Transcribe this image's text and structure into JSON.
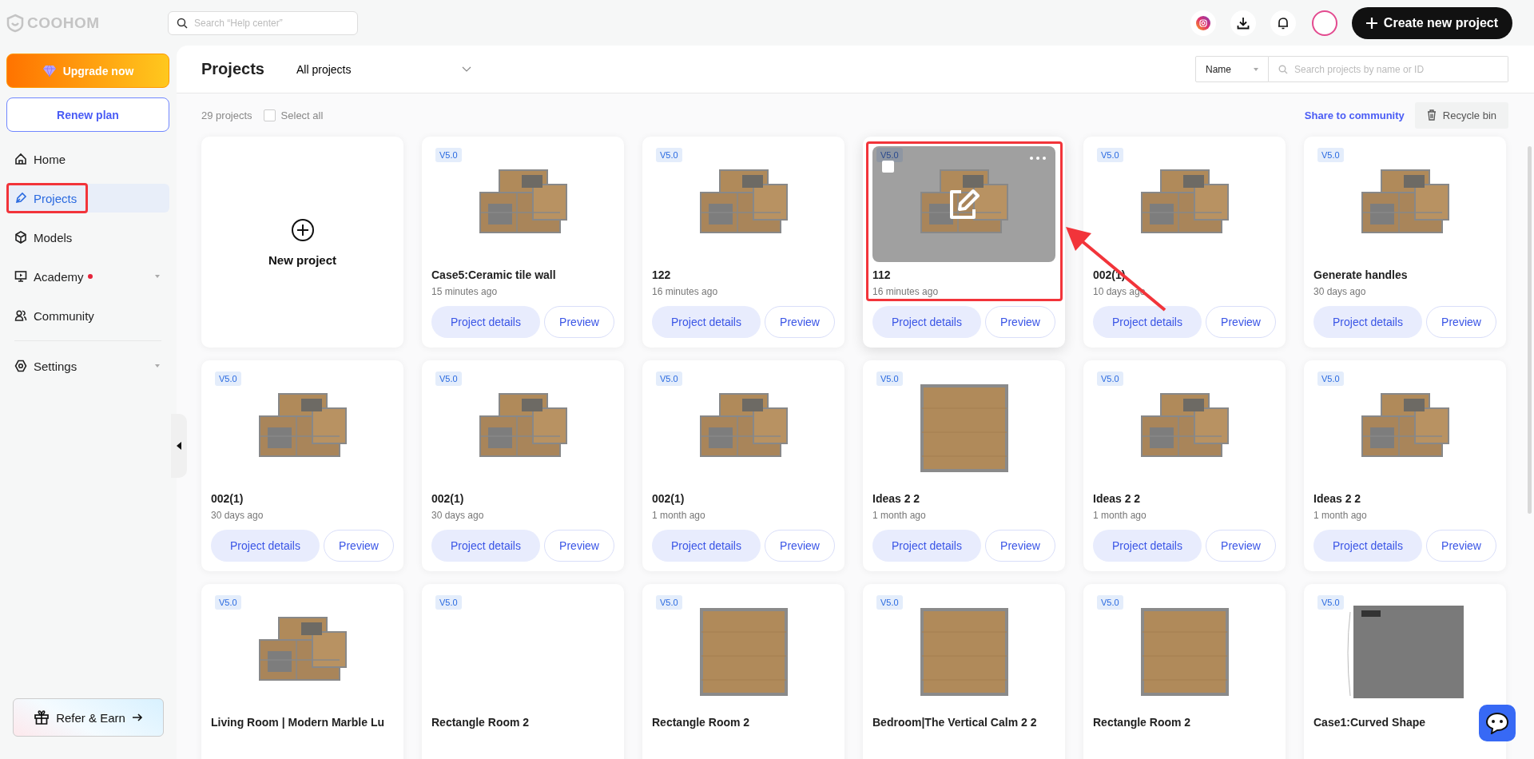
{
  "topbar": {
    "logo": "COOHOM",
    "search": {
      "placeholder": "Search “Help center”"
    },
    "create_button": "Create new project"
  },
  "sidebar": {
    "upgrade_button": "Upgrade now",
    "renew_button": "Renew plan",
    "items": [
      {
        "label": "Home",
        "kind": "home",
        "selected": false,
        "highlighted": false,
        "dot": false,
        "expandable": false
      },
      {
        "label": "Projects",
        "kind": "pen",
        "selected": true,
        "highlighted": true,
        "dot": false,
        "expandable": false
      },
      {
        "label": "Models",
        "kind": "cube",
        "selected": false,
        "highlighted": false,
        "dot": false,
        "expandable": false
      },
      {
        "label": "Academy",
        "kind": "monitor",
        "selected": false,
        "highlighted": false,
        "dot": true,
        "expandable": true
      },
      {
        "label": "Community",
        "kind": "people",
        "selected": false,
        "highlighted": false,
        "dot": false,
        "expandable": false
      },
      {
        "label": "Settings",
        "kind": "gear",
        "selected": false,
        "highlighted": false,
        "dot": false,
        "expandable": true
      }
    ],
    "refer_button": "Refer & Earn"
  },
  "header": {
    "title": "Projects",
    "filter": "All projects",
    "sort": "Name",
    "search": {
      "placeholder": "Search projects by name or ID"
    }
  },
  "toolbar": {
    "count": "29 projects",
    "select_all": {
      "label": "Select all",
      "checked": false
    },
    "share_link": "Share to community",
    "recycle_button": "Recycle bin"
  },
  "cards": [
    {
      "kind": "new",
      "label": "New project"
    },
    {
      "kind": "project",
      "badge": "V5.0",
      "title": "Case5:Ceramic tile wall",
      "time": "15 minutes ago",
      "has_thumbnail": true,
      "hovered": false,
      "highlighted": false,
      "details_button": "Project details",
      "preview_button": "Preview"
    },
    {
      "kind": "project",
      "badge": "V5.0",
      "title": "122",
      "time": "16 minutes ago",
      "has_thumbnail": true,
      "hovered": false,
      "highlighted": false,
      "details_button": "Project details",
      "preview_button": "Preview"
    },
    {
      "kind": "project",
      "badge": "V5.0",
      "title": "112",
      "time": "16 minutes ago",
      "has_thumbnail": true,
      "hovered": true,
      "highlighted": true,
      "details_button": "Project details",
      "preview_button": "Preview"
    },
    {
      "kind": "project",
      "badge": "V5.0",
      "title": "002(1)",
      "time": "10 days ago",
      "has_thumbnail": true,
      "hovered": false,
      "highlighted": false,
      "details_button": "Project details",
      "preview_button": "Preview"
    },
    {
      "kind": "project",
      "badge": "V5.0",
      "title": "Generate handles",
      "time": "30 days ago",
      "has_thumbnail": true,
      "hovered": false,
      "highlighted": false,
      "details_button": "Project details",
      "preview_button": "Preview"
    },
    {
      "kind": "project",
      "badge": "V5.0",
      "title": "002(1)",
      "time": "30 days ago",
      "has_thumbnail": true,
      "hovered": false,
      "highlighted": false,
      "details_button": "Project details",
      "preview_button": "Preview"
    },
    {
      "kind": "project",
      "badge": "V5.0",
      "title": "002(1)",
      "time": "30 days ago",
      "has_thumbnail": true,
      "hovered": false,
      "highlighted": false,
      "details_button": "Project details",
      "preview_button": "Preview"
    },
    {
      "kind": "project",
      "badge": "V5.0",
      "title": "002(1)",
      "time": "1 month ago",
      "has_thumbnail": true,
      "hovered": false,
      "highlighted": false,
      "details_button": "Project details",
      "preview_button": "Preview"
    },
    {
      "kind": "project",
      "badge": "V5.0",
      "title": "Ideas 2 2",
      "time": "1 month ago",
      "has_thumbnail": true,
      "hovered": false,
      "highlighted": false,
      "details_button": "Project details",
      "preview_button": "Preview"
    },
    {
      "kind": "project",
      "badge": "V5.0",
      "title": "Ideas 2 2",
      "time": "1 month ago",
      "has_thumbnail": true,
      "hovered": false,
      "highlighted": false,
      "details_button": "Project details",
      "preview_button": "Preview"
    },
    {
      "kind": "project",
      "badge": "V5.0",
      "title": "Ideas 2 2",
      "time": "1 month ago",
      "has_thumbnail": true,
      "hovered": false,
      "highlighted": false,
      "details_button": "Project details",
      "preview_button": "Preview"
    },
    {
      "kind": "project",
      "badge": "V5.0",
      "title": "Living Room | Modern Marble Lu",
      "has_thumbnail": true,
      "hovered": false,
      "highlighted": false
    },
    {
      "kind": "project",
      "badge": "V5.0",
      "title": "Rectangle Room 2",
      "has_thumbnail": false,
      "hovered": false,
      "highlighted": false
    },
    {
      "kind": "project",
      "badge": "V5.0",
      "title": "Rectangle Room 2",
      "has_thumbnail": true,
      "hovered": false,
      "highlighted": false
    },
    {
      "kind": "project",
      "badge": "V5.0",
      "title": "Bedroom|The Vertical Calm 2 2",
      "has_thumbnail": true,
      "hovered": false,
      "highlighted": false
    },
    {
      "kind": "project",
      "badge": "V5.0",
      "title": "Rectangle Room 2",
      "has_thumbnail": true,
      "hovered": false,
      "highlighted": false
    },
    {
      "kind": "project",
      "badge": "V5.0",
      "title": "Case1:Curved Shape",
      "has_thumbnail": true,
      "hovered": false,
      "highlighted": false
    }
  ],
  "annotations": [
    {
      "kind": "arrow"
    }
  ]
}
